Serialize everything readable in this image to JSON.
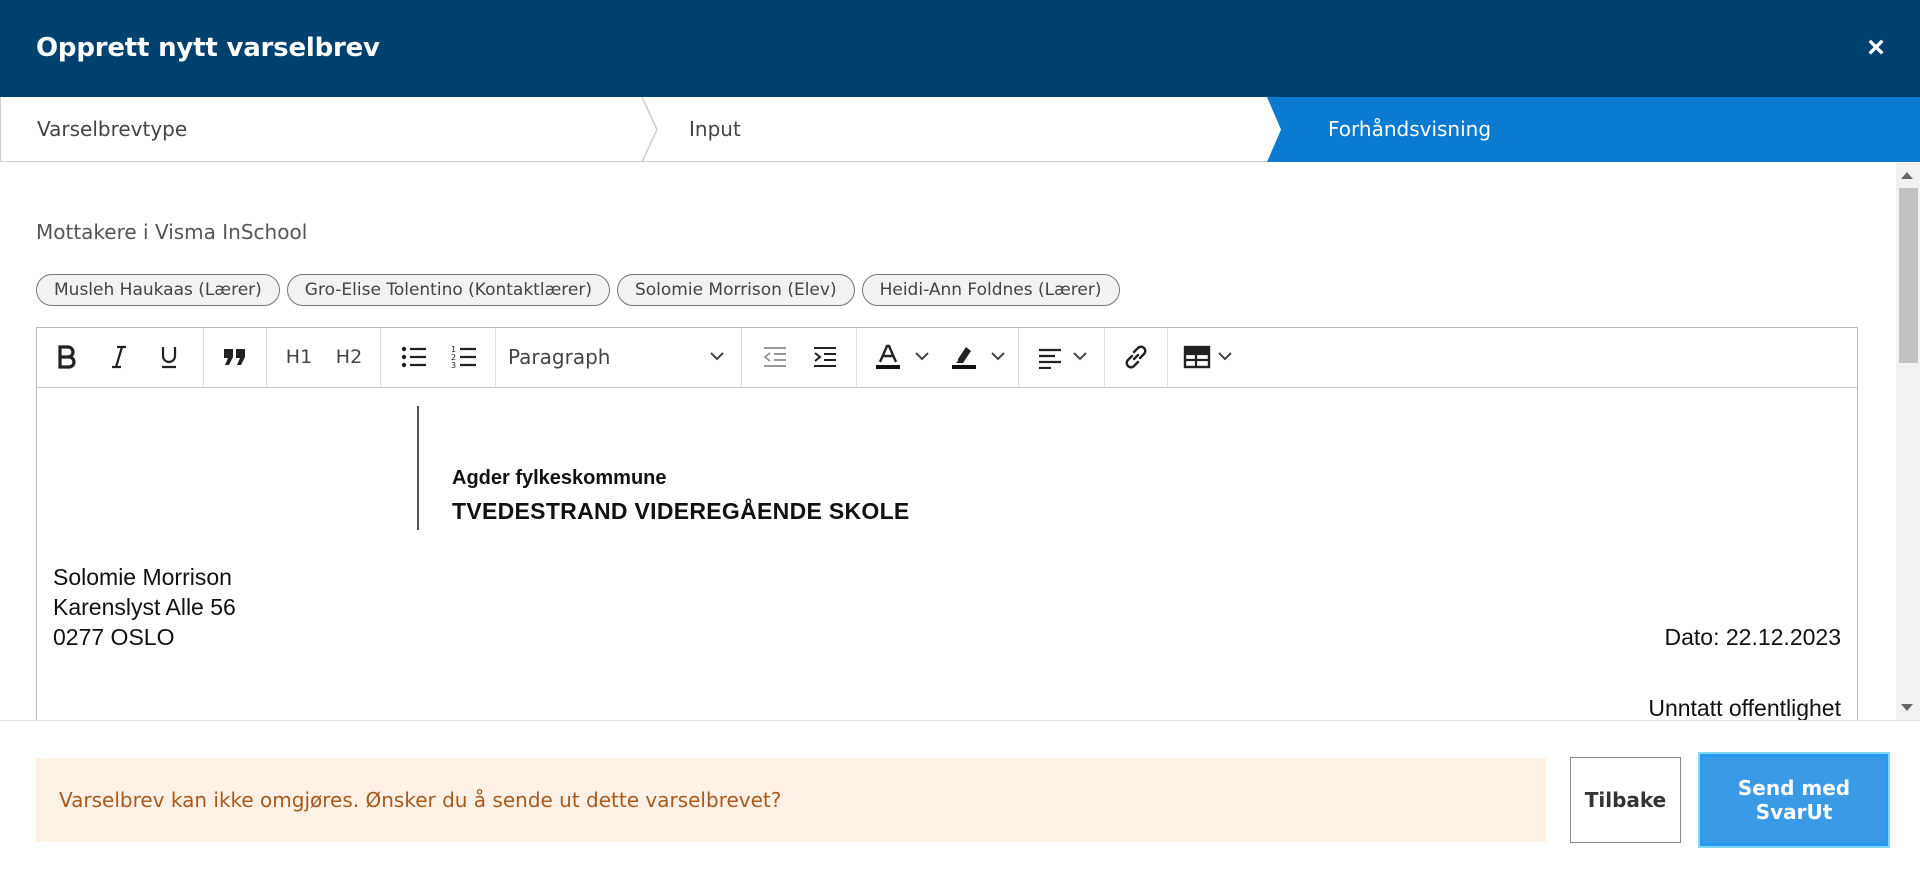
{
  "header": {
    "title": "Opprett nytt varselbrev",
    "close_label": "×"
  },
  "stepper": {
    "steps": [
      "Varselbrevtype",
      "Input",
      "Forhåndsvisning"
    ],
    "active_index": 2
  },
  "recipients": {
    "label": "Mottakere i Visma InSchool",
    "chips": [
      "Musleh Haukaas (Lærer)",
      "Gro-Elise Tolentino (Kontaktlærer)",
      "Solomie Morrison (Elev)",
      "Heidi-Ann Foldnes (Lærer)"
    ]
  },
  "toolbar": {
    "h1": "H1",
    "h2": "H2",
    "format_select": "Paragraph",
    "icons": [
      "bold-icon",
      "italic-icon",
      "underline-icon",
      "quote-icon",
      "bullet-list-icon",
      "numbered-list-icon",
      "outdent-icon",
      "indent-icon",
      "text-color-icon",
      "highlight-icon",
      "align-icon",
      "link-icon",
      "table-icon"
    ]
  },
  "document": {
    "org": "Agder fylkeskommune",
    "school": "TVEDESTRAND VIDEREGÅENDE SKOLE",
    "address": [
      "Solomie Morrison",
      "Karenslyst Alle 56",
      "0277 OSLO"
    ],
    "date": "Dato: 22.12.2023",
    "classification": "Unntatt offentlighet"
  },
  "footer": {
    "warning": "Varselbrev kan ikke omgjøres. Ønsker du å sende ut dette varselbrevet?",
    "back_label": "Tilbake",
    "send_label": "Send med SvarUt"
  },
  "colors": {
    "header_bg": "#00416f",
    "active_step": "#0a7bd0",
    "primary_button": "#3b9ae6",
    "warning_bg": "#fdf0e4",
    "warning_text": "#a85a1d"
  }
}
